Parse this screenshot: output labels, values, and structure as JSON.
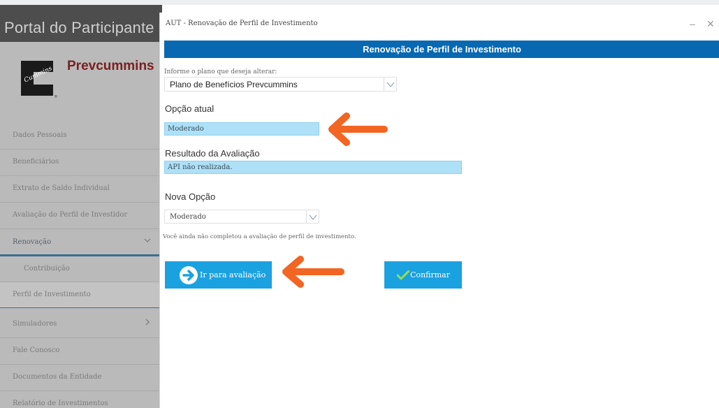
{
  "portal": {
    "title": "Portal do Participante",
    "brand": "Prevcummins",
    "logo_text": "Cummins",
    "nav": [
      {
        "label": "Dados Pessoais"
      },
      {
        "label": "Beneficiários"
      },
      {
        "label": "Extrato de Saldo Individual"
      },
      {
        "label": "Avaliação do Perfil de Investidor"
      },
      {
        "label": "Renovação",
        "expanded": true
      }
    ],
    "sub_nav": [
      {
        "label": "Contribuição"
      },
      {
        "label": "Perfil de Investimento",
        "selected": true
      }
    ],
    "nav_after": [
      {
        "label": "Simuladores"
      },
      {
        "label": "Fale Conosco"
      },
      {
        "label": "Documentos da Entidade"
      },
      {
        "label": "Relatório de Investimentos"
      }
    ]
  },
  "modal": {
    "title": "AUT - Renovação de Perfil de Investimento",
    "banner": "Renovação de Perfil de Investimento",
    "plan_label": "Informe o plano que deseja alterar:",
    "plan_value": "Plano de Benefícios Prevcummins",
    "current_heading": "Opção atual",
    "current_value": "Moderado",
    "result_heading": "Resultado da Avaliação",
    "result_value": "API não realizada.",
    "new_heading": "Nova Opção",
    "new_value": "Moderado",
    "note": "Você ainda não completou a avaliação de perfil de investimento.",
    "btn_go": "Ir para avaliação",
    "btn_confirm": "Confirmar"
  },
  "colors": {
    "banner": "#0868b2",
    "button": "#1aa1e0",
    "info_box": "#aee1f7",
    "annotation_arrow": "#f26522"
  }
}
